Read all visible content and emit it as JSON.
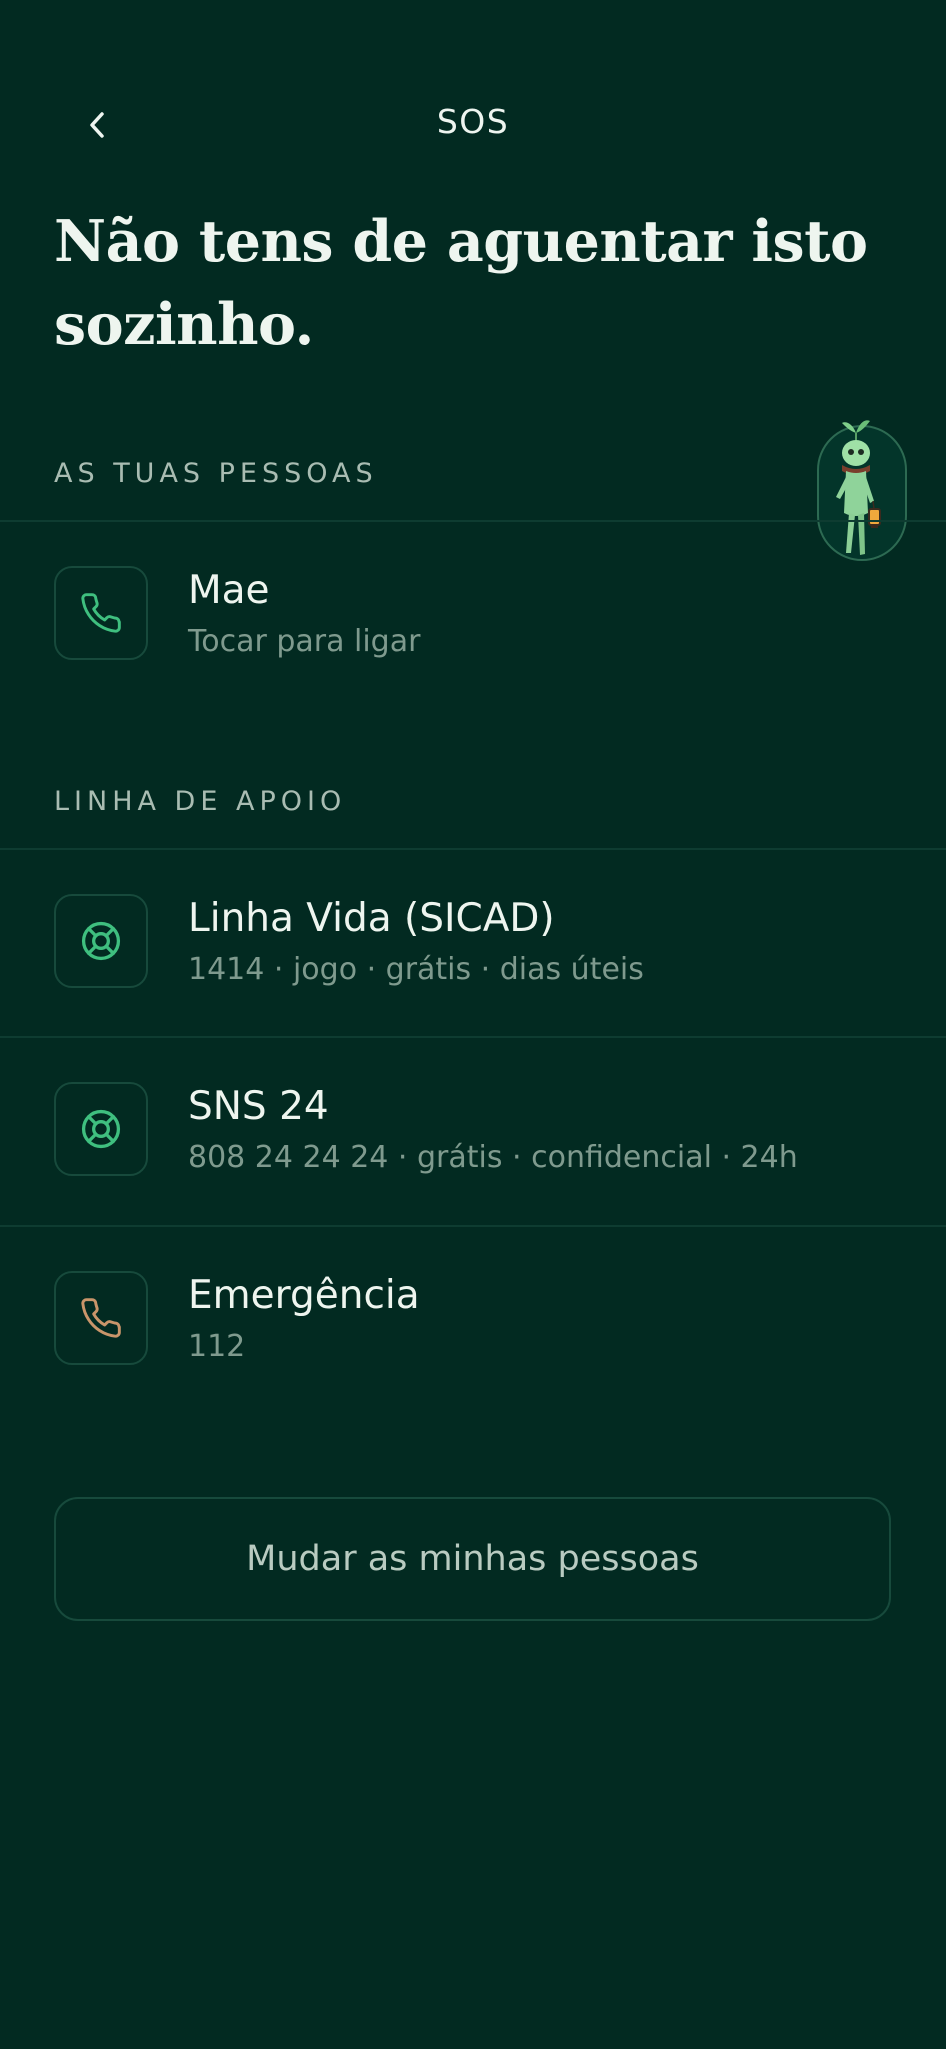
{
  "header": {
    "title": "SOS",
    "back_icon": "chevron-left-icon"
  },
  "headline": {
    "line1": "Não tens de aguentar isto",
    "line2": "sozinho."
  },
  "people_section": {
    "label": "AS TUAS PESSOAS",
    "contacts": [
      {
        "name": "Mae",
        "subtitle": "Tocar para ligar",
        "icon": "phone-icon",
        "icon_color": "#3fbf7f"
      }
    ]
  },
  "support_section": {
    "label": "LINHA DE APOIO",
    "lines": [
      {
        "name": "Linha Vida (SICAD)",
        "subtitle": "1414 · jogo · grátis · dias úteis",
        "icon": "lifebuoy-icon",
        "icon_color": "#3fbf7f"
      },
      {
        "name": "SNS 24",
        "subtitle": "808 24 24 24 · grátis · confidencial · 24h",
        "icon": "lifebuoy-icon",
        "icon_color": "#3fbf7f"
      },
      {
        "name": "Emergência",
        "subtitle": "112",
        "icon": "phone-icon",
        "icon_color": "#c9956a"
      }
    ]
  },
  "change_people_button": {
    "label": "Mudar as minhas pessoas"
  },
  "mascot": {
    "icon": "sprout-mascot-with-lantern"
  },
  "colors": {
    "background": "#022a21",
    "accent_green": "#3fbf7f",
    "emergency_orange": "#c9956a",
    "muted_text": "#7f9a8e"
  }
}
